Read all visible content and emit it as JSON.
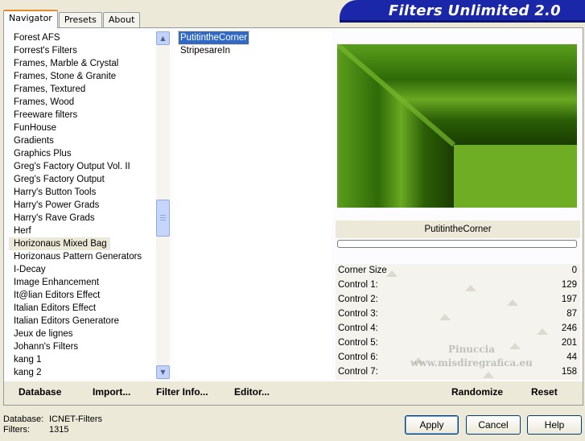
{
  "tabs": [
    {
      "label": "Navigator",
      "active": true
    },
    {
      "label": "Presets",
      "active": false
    },
    {
      "label": "About",
      "active": false
    }
  ],
  "banner": {
    "title": "Filters Unlimited 2.0"
  },
  "categories": {
    "items": [
      "Forest AFS",
      "Forrest's Filters",
      "Frames, Marble & Crystal",
      "Frames, Stone & Granite",
      "Frames, Textured",
      "Frames, Wood",
      "Freeware filters",
      "FunHouse",
      "Gradients",
      "Graphics Plus",
      "Greg's Factory Output Vol. II",
      "Greg's Factory Output",
      "Harry's Button Tools",
      "Harry's Power Grads",
      "Harry's Rave Grads",
      "Herf",
      "Horizonaus Mixed Bag",
      "Horizonaus Pattern Generators",
      "I-Decay",
      "Image Enhancement",
      "It@lian Editors Effect",
      "Italian Editors Effect",
      "Italian Editors Generatore",
      "Jeux de lignes",
      "Johann's Filters",
      "kang 1",
      "kang 2"
    ],
    "selected": "Horizonaus Mixed Bag"
  },
  "filters": {
    "items": [
      "PutitintheCorner",
      "StripesareIn"
    ],
    "selected": "PutitintheCorner"
  },
  "preview": {
    "filter_name": "PutitintheCorner",
    "progress": 0
  },
  "controls": [
    {
      "label": "Corner Size",
      "value": "0"
    },
    {
      "label": "Control 1:",
      "value": "129"
    },
    {
      "label": "Control 2:",
      "value": "197"
    },
    {
      "label": "Control 3:",
      "value": "87"
    },
    {
      "label": "Control 4:",
      "value": "246"
    },
    {
      "label": "Control 5:",
      "value": "201"
    },
    {
      "label": "Control 6:",
      "value": "44"
    },
    {
      "label": "Control 7:",
      "value": "158"
    }
  ],
  "watermark": {
    "line1": "Pinuccia",
    "line2": "www.misdiregrafica.eu"
  },
  "actions": {
    "database": "Database",
    "import": "Import...",
    "filter_info": "Filter Info...",
    "editor": "Editor...",
    "randomize": "Randomize",
    "reset": "Reset"
  },
  "footer": {
    "database_label": "Database:",
    "database_value": "ICNET-Filters",
    "filters_label": "Filters:",
    "filters_value": "1315"
  },
  "buttons": {
    "apply": "Apply",
    "cancel": "Cancel",
    "help": "Help"
  },
  "colors": {
    "preview_green": "#4a8f14",
    "selection_blue": "#316ac5",
    "banner_blue": "#1a27a8"
  }
}
